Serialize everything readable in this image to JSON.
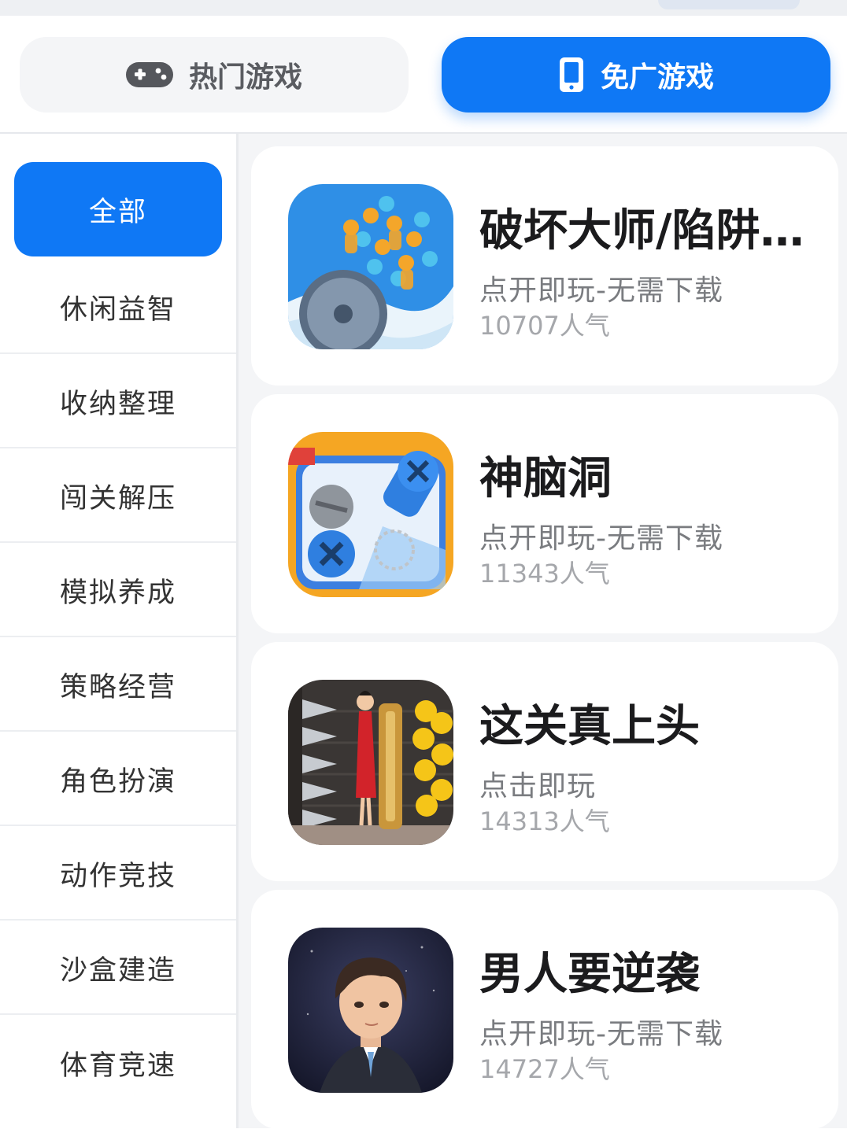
{
  "tabs": {
    "hot": {
      "label": "热门游戏",
      "icon": "gamepad-icon"
    },
    "adfree": {
      "label": "免广游戏",
      "icon": "phone-icon",
      "selected": true
    }
  },
  "categories": [
    "全部",
    "休闲益智",
    "收纳整理",
    "闯关解压",
    "模拟养成",
    "策略经营",
    "角色扮演",
    "动作竞技",
    "沙盒建造",
    "体育竞速"
  ],
  "selected_category": "全部",
  "games": [
    {
      "name": "破坏大师/陷阱...",
      "subtitle": "点开即玩-无需下载",
      "popularity": "10707人气"
    },
    {
      "name": "神脑洞",
      "subtitle": "点开即玩-无需下载",
      "popularity": "11343人气"
    },
    {
      "name": "这关真上头",
      "subtitle": "点击即玩",
      "popularity": "14313人气"
    },
    {
      "name": "男人要逆袭",
      "subtitle": "点开即玩-无需下载",
      "popularity": "14727人气"
    }
  ],
  "colors": {
    "accent": "#0f78f5",
    "background": "#f4f5f7"
  }
}
